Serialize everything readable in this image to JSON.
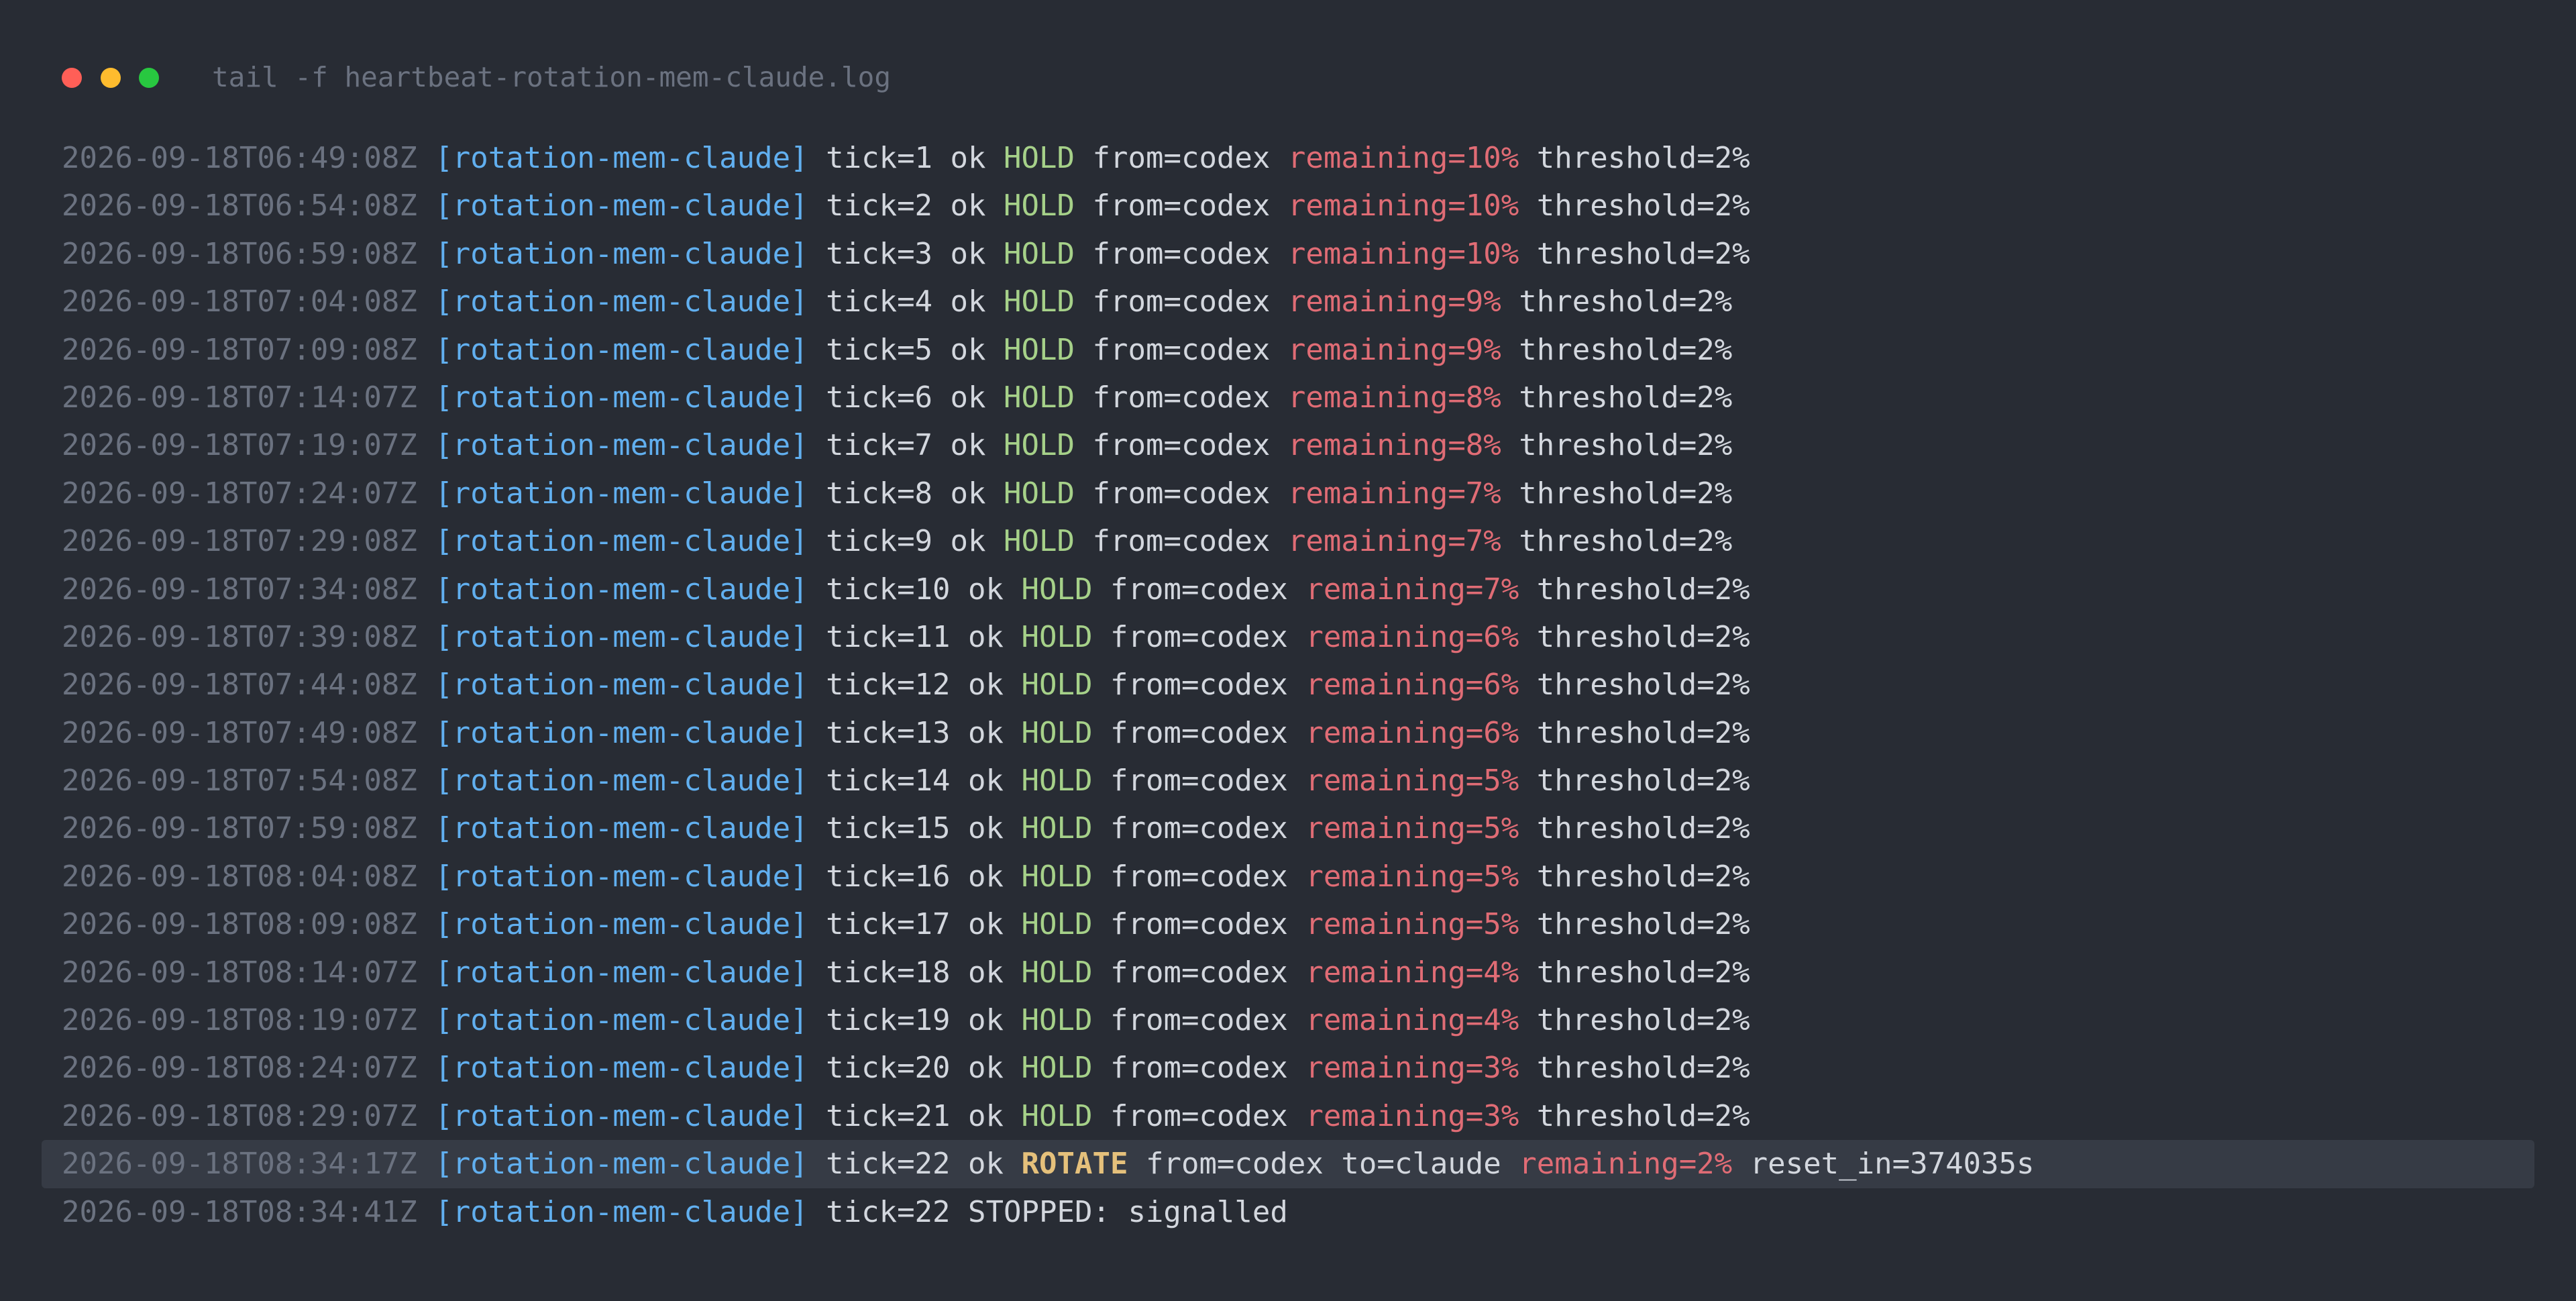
{
  "window": {
    "title": "tail -f heartbeat-rotation-mem-claude.log",
    "controls": [
      "close",
      "minimize",
      "maximize"
    ]
  },
  "colors": {
    "background": "#282c34",
    "timestamp": "#6b7280",
    "tag": "#61afef",
    "text": "#d3d7de",
    "hold": "#a6d189",
    "rotate": "#e5c07b",
    "remaining": "#e06c75",
    "highlight_row": "#363b45"
  },
  "log": [
    {
      "ts": "2026-09-18T06:49:08Z",
      "tag": "[rotation-mem-claude]",
      "body": "tick=1 ok",
      "action": "HOLD",
      "detail": "from=codex",
      "remaining": "remaining=10%",
      "tail": "threshold=2%"
    },
    {
      "ts": "2026-09-18T06:54:08Z",
      "tag": "[rotation-mem-claude]",
      "body": "tick=2 ok",
      "action": "HOLD",
      "detail": "from=codex",
      "remaining": "remaining=10%",
      "tail": "threshold=2%"
    },
    {
      "ts": "2026-09-18T06:59:08Z",
      "tag": "[rotation-mem-claude]",
      "body": "tick=3 ok",
      "action": "HOLD",
      "detail": "from=codex",
      "remaining": "remaining=10%",
      "tail": "threshold=2%"
    },
    {
      "ts": "2026-09-18T07:04:08Z",
      "tag": "[rotation-mem-claude]",
      "body": "tick=4 ok",
      "action": "HOLD",
      "detail": "from=codex",
      "remaining": "remaining=9%",
      "tail": "threshold=2%"
    },
    {
      "ts": "2026-09-18T07:09:08Z",
      "tag": "[rotation-mem-claude]",
      "body": "tick=5 ok",
      "action": "HOLD",
      "detail": "from=codex",
      "remaining": "remaining=9%",
      "tail": "threshold=2%"
    },
    {
      "ts": "2026-09-18T07:14:07Z",
      "tag": "[rotation-mem-claude]",
      "body": "tick=6 ok",
      "action": "HOLD",
      "detail": "from=codex",
      "remaining": "remaining=8%",
      "tail": "threshold=2%"
    },
    {
      "ts": "2026-09-18T07:19:07Z",
      "tag": "[rotation-mem-claude]",
      "body": "tick=7 ok",
      "action": "HOLD",
      "detail": "from=codex",
      "remaining": "remaining=8%",
      "tail": "threshold=2%"
    },
    {
      "ts": "2026-09-18T07:24:07Z",
      "tag": "[rotation-mem-claude]",
      "body": "tick=8 ok",
      "action": "HOLD",
      "detail": "from=codex",
      "remaining": "remaining=7%",
      "tail": "threshold=2%"
    },
    {
      "ts": "2026-09-18T07:29:08Z",
      "tag": "[rotation-mem-claude]",
      "body": "tick=9 ok",
      "action": "HOLD",
      "detail": "from=codex",
      "remaining": "remaining=7%",
      "tail": "threshold=2%"
    },
    {
      "ts": "2026-09-18T07:34:08Z",
      "tag": "[rotation-mem-claude]",
      "body": "tick=10 ok",
      "action": "HOLD",
      "detail": "from=codex",
      "remaining": "remaining=7%",
      "tail": "threshold=2%"
    },
    {
      "ts": "2026-09-18T07:39:08Z",
      "tag": "[rotation-mem-claude]",
      "body": "tick=11 ok",
      "action": "HOLD",
      "detail": "from=codex",
      "remaining": "remaining=6%",
      "tail": "threshold=2%"
    },
    {
      "ts": "2026-09-18T07:44:08Z",
      "tag": "[rotation-mem-claude]",
      "body": "tick=12 ok",
      "action": "HOLD",
      "detail": "from=codex",
      "remaining": "remaining=6%",
      "tail": "threshold=2%"
    },
    {
      "ts": "2026-09-18T07:49:08Z",
      "tag": "[rotation-mem-claude]",
      "body": "tick=13 ok",
      "action": "HOLD",
      "detail": "from=codex",
      "remaining": "remaining=6%",
      "tail": "threshold=2%"
    },
    {
      "ts": "2026-09-18T07:54:08Z",
      "tag": "[rotation-mem-claude]",
      "body": "tick=14 ok",
      "action": "HOLD",
      "detail": "from=codex",
      "remaining": "remaining=5%",
      "tail": "threshold=2%"
    },
    {
      "ts": "2026-09-18T07:59:08Z",
      "tag": "[rotation-mem-claude]",
      "body": "tick=15 ok",
      "action": "HOLD",
      "detail": "from=codex",
      "remaining": "remaining=5%",
      "tail": "threshold=2%"
    },
    {
      "ts": "2026-09-18T08:04:08Z",
      "tag": "[rotation-mem-claude]",
      "body": "tick=16 ok",
      "action": "HOLD",
      "detail": "from=codex",
      "remaining": "remaining=5%",
      "tail": "threshold=2%"
    },
    {
      "ts": "2026-09-18T08:09:08Z",
      "tag": "[rotation-mem-claude]",
      "body": "tick=17 ok",
      "action": "HOLD",
      "detail": "from=codex",
      "remaining": "remaining=5%",
      "tail": "threshold=2%"
    },
    {
      "ts": "2026-09-18T08:14:07Z",
      "tag": "[rotation-mem-claude]",
      "body": "tick=18 ok",
      "action": "HOLD",
      "detail": "from=codex",
      "remaining": "remaining=4%",
      "tail": "threshold=2%"
    },
    {
      "ts": "2026-09-18T08:19:07Z",
      "tag": "[rotation-mem-claude]",
      "body": "tick=19 ok",
      "action": "HOLD",
      "detail": "from=codex",
      "remaining": "remaining=4%",
      "tail": "threshold=2%"
    },
    {
      "ts": "2026-09-18T08:24:07Z",
      "tag": "[rotation-mem-claude]",
      "body": "tick=20 ok",
      "action": "HOLD",
      "detail": "from=codex",
      "remaining": "remaining=3%",
      "tail": "threshold=2%"
    },
    {
      "ts": "2026-09-18T08:29:07Z",
      "tag": "[rotation-mem-claude]",
      "body": "tick=21 ok",
      "action": "HOLD",
      "detail": "from=codex",
      "remaining": "remaining=3%",
      "tail": "threshold=2%"
    },
    {
      "ts": "2026-09-18T08:34:17Z",
      "tag": "[rotation-mem-claude]",
      "body": "tick=22 ok",
      "action": "ROTATE",
      "detail": "from=codex to=claude",
      "remaining": "remaining=2%",
      "tail": "reset_in=374035s",
      "highlight": true
    },
    {
      "ts": "2026-09-18T08:34:41Z",
      "tag": "[rotation-mem-claude]",
      "body": "tick=22 STOPPED: signalled"
    }
  ]
}
